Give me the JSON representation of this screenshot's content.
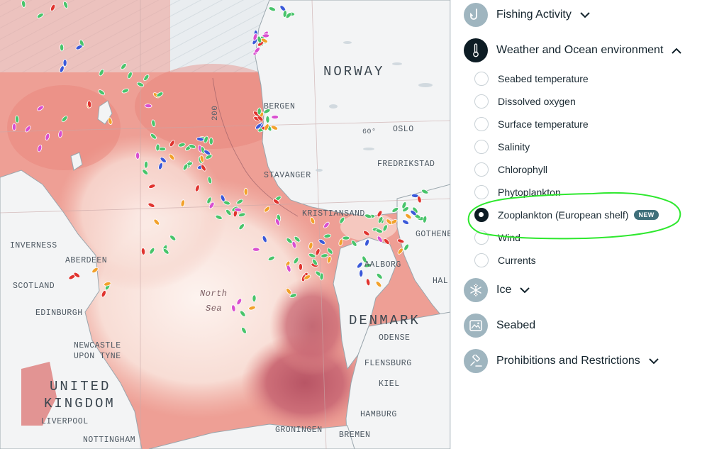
{
  "panel": {
    "sections": [
      {
        "key": "fishing",
        "title": "Fishing Activity",
        "icon": "fishing-hook-icon",
        "state": "collapsed"
      },
      {
        "key": "weather",
        "title": "Weather and Ocean environment",
        "icon": "thermometer-icon",
        "state": "expanded"
      },
      {
        "key": "ice",
        "title": "Ice",
        "icon": "snowflake-icon",
        "state": "collapsed"
      },
      {
        "key": "seabed",
        "title": "Seabed",
        "icon": "image-icon",
        "state": "none"
      },
      {
        "key": "prohibitions",
        "title": "Prohibitions and Restrictions",
        "icon": "gavel-icon",
        "state": "collapsed"
      }
    ],
    "weather_layers": [
      {
        "label": "Seabed temperature",
        "selected": false
      },
      {
        "label": "Dissolved oxygen",
        "selected": false
      },
      {
        "label": "Surface temperature",
        "selected": false
      },
      {
        "label": "Salinity",
        "selected": false
      },
      {
        "label": "Chlorophyll",
        "selected": false
      },
      {
        "label": "Phytoplankton",
        "selected": false
      },
      {
        "label": "Zooplankton (European shelf)",
        "selected": true,
        "badge": "NEW"
      },
      {
        "label": "Wind",
        "selected": false
      },
      {
        "label": "Currents",
        "selected": false
      }
    ],
    "annotation_color": "#2ee82e"
  },
  "map": {
    "labels": {
      "norway": "NORWAY",
      "denmark": "DENMARK",
      "uk_1": "UNITED",
      "uk_2": "KINGDOM",
      "scotland": "SCOTLAND",
      "inverness": "INVERNESS",
      "aberdeen": "ABERDEEN",
      "edinburgh": "EDINBURGH",
      "newcastle_1": "NEWCASTLE",
      "newcastle_2": "UPON TYNE",
      "liverpool": "LIVERPOOL",
      "nottingham": "NOTTINGHAM",
      "stavanger": "STAVANGER",
      "bergen": "BERGEN",
      "oslo": "OSLO",
      "fredrikstad": "FREDRIKSTAD",
      "kristiansand": "KRISTIANSAND",
      "aalborg": "AALBORG",
      "gothenburg": "GOTHENBU",
      "halmstad": "HAL",
      "odense": "ODENSE",
      "flensburg": "FLENSBURG",
      "kiel": "KIEL",
      "hamburg": "HAMBURG",
      "bremen": "BREMEN",
      "groningen": "GRONINGEN",
      "north_sea_1": "North",
      "north_sea_2": "Sea",
      "depth_200": "200",
      "lat_60": "60°"
    },
    "colors": {
      "ocean_light": "#fbe6e0",
      "ocean_mid": "#f2b0a6",
      "ocean_strong": "#e57c74",
      "ocean_deep": "#c8646a",
      "land": "#f3f4f5",
      "vessel_green": "#49c46b",
      "vessel_magenta": "#d94fd0",
      "vessel_red": "#e0342f",
      "vessel_orange": "#f2a12b",
      "vessel_blue": "#3a59d9"
    }
  }
}
